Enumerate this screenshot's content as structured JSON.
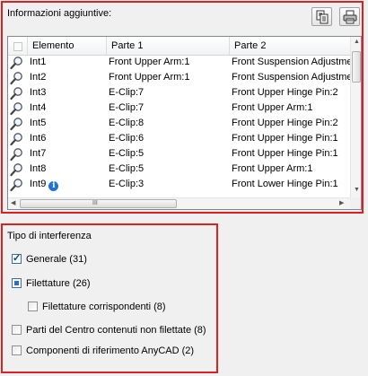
{
  "interference": {
    "title": "Informazioni aggiuntive:",
    "toolbar": {
      "copy_icon": "copy-icon",
      "print_icon": "print-icon"
    },
    "columns": [
      "Elemento",
      "Parte 1",
      "Parte 2"
    ],
    "rows": [
      {
        "element": "Int1",
        "part1": "Front Upper Arm:1",
        "part2": "Front Suspension Adjustment",
        "info": false
      },
      {
        "element": "Int2",
        "part1": "Front Upper Arm:1",
        "part2": "Front Suspension Adjustment",
        "info": false
      },
      {
        "element": "Int3",
        "part1": "E-Clip:7",
        "part2": "Front Upper Hinge Pin:2",
        "info": false
      },
      {
        "element": "Int4",
        "part1": "E-Clip:7",
        "part2": "Front Upper Arm:1",
        "info": false
      },
      {
        "element": "Int5",
        "part1": "E-Clip:8",
        "part2": "Front Upper Hinge Pin:2",
        "info": false
      },
      {
        "element": "Int6",
        "part1": "E-Clip:6",
        "part2": "Front Upper Hinge Pin:1",
        "info": false
      },
      {
        "element": "Int7",
        "part1": "E-Clip:5",
        "part2": "Front Upper Hinge Pin:1",
        "info": false
      },
      {
        "element": "Int8",
        "part1": "E-Clip:5",
        "part2": "Front Upper Arm:1",
        "info": false
      },
      {
        "element": "Int9",
        "part1": "E-Clip:3",
        "part2": "Front Lower Hinge Pin:1",
        "info": true
      }
    ],
    "info_glyph": "i",
    "scroll_grip": "III"
  },
  "filter": {
    "title": "Tipo di interferenza",
    "options": [
      {
        "label": "Generale (31)",
        "state": "checked"
      },
      {
        "label": "Filettature (26)",
        "state": "partial"
      },
      {
        "label": "Filettature corrispondenti (8)",
        "state": "unchecked"
      },
      {
        "label": "Parti del Centro contenuti non filettate (8)",
        "state": "unchecked"
      },
      {
        "label": "Componenti di riferimento AnyCAD (2)",
        "state": "unchecked"
      }
    ]
  },
  "colors": {
    "highlight_border": "#e02020",
    "info_badge": "#1e73d8"
  }
}
